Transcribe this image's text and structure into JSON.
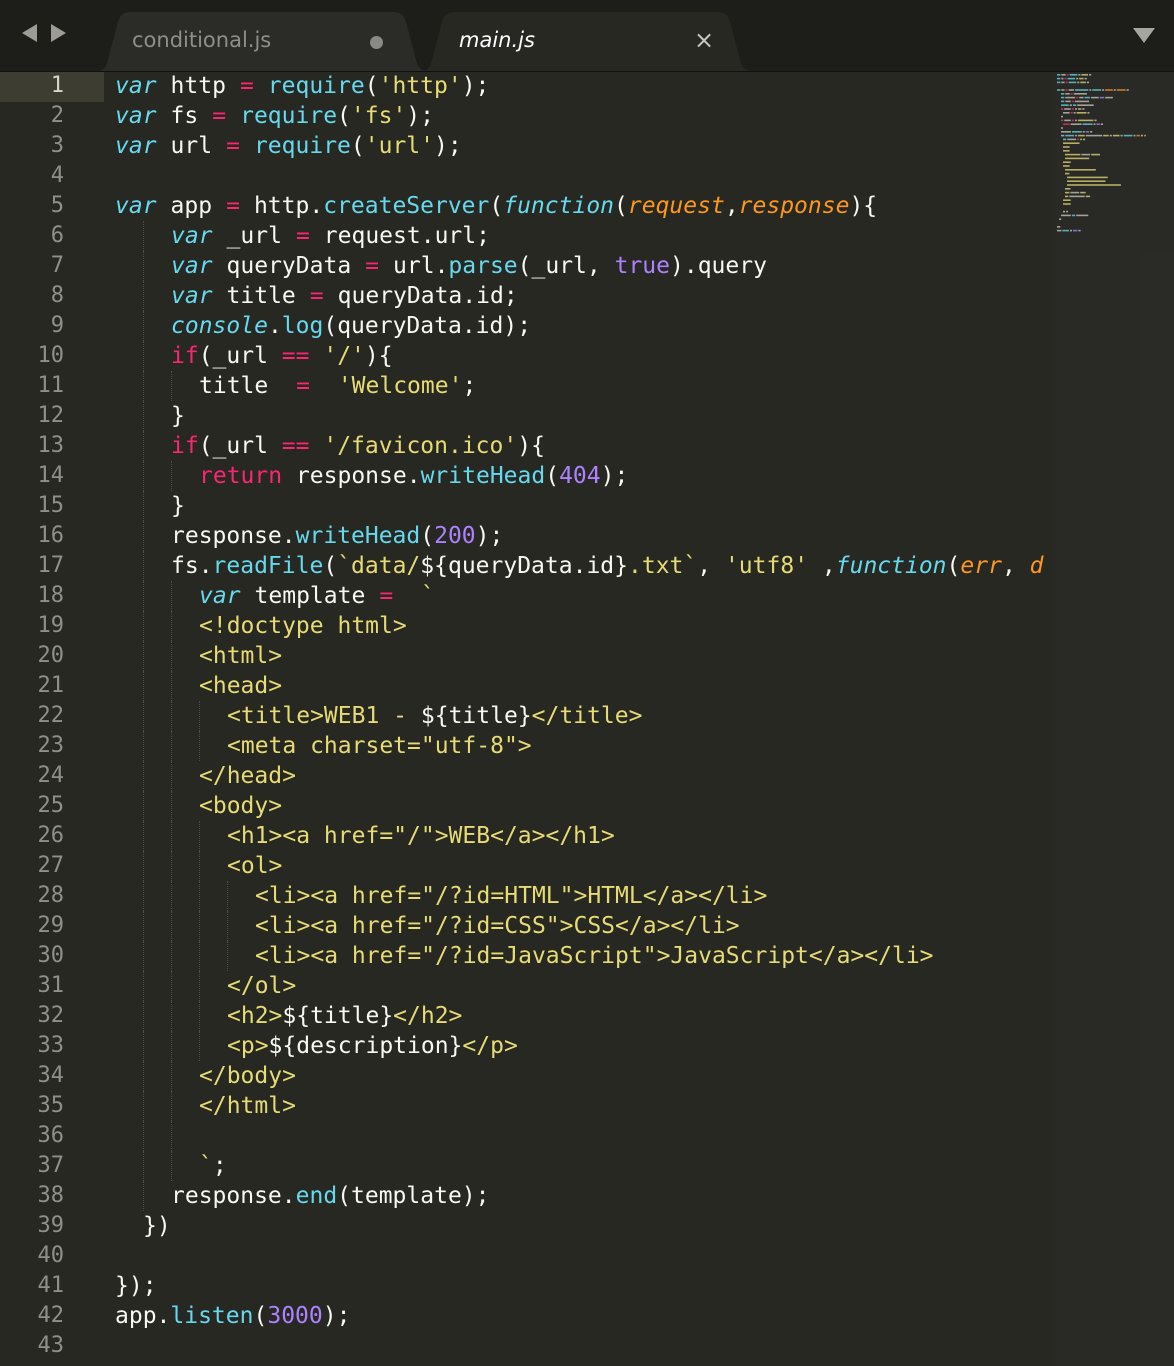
{
  "tabs": [
    {
      "label": "conditional.js",
      "active": false,
      "modified": true
    },
    {
      "label": "main.js",
      "active": true,
      "close_icon": "×"
    }
  ],
  "icons": {
    "back": "left-triangle-icon",
    "forward": "right-triangle-icon",
    "dropdown": "down-triangle-icon",
    "modified": "dot-icon",
    "close": "close-icon"
  },
  "colors": {
    "background": "#272822",
    "foreground": "#f8f8f2",
    "keyword": "#f92672",
    "storage": "#66d9ef",
    "string": "#e6db74",
    "number": "#ae81ff",
    "parameter": "#fd971f",
    "line_number": "#8f908a"
  },
  "editor": {
    "current_line": 1,
    "line_numbers": [
      "1",
      "2",
      "3",
      "4",
      "5",
      "6",
      "7",
      "8",
      "9",
      "10",
      "11",
      "12",
      "13",
      "14",
      "15",
      "16",
      "17",
      "18",
      "19",
      "20",
      "21",
      "22",
      "23",
      "24",
      "25",
      "26",
      "27",
      "28",
      "29",
      "30",
      "31",
      "32",
      "33",
      "34",
      "35",
      "36",
      "37",
      "38",
      "39",
      "40",
      "41",
      "42",
      "43"
    ],
    "lines": [
      [
        [
          "k",
          "var"
        ],
        [
          "",
          "http"
        ],
        [
          "op",
          "="
        ],
        [
          "fn",
          "require"
        ],
        [
          "",
          "("
        ],
        [
          "s",
          "'http'"
        ],
        [
          "",
          ");"
        ]
      ],
      [
        [
          "k",
          "var"
        ],
        [
          "",
          "fs"
        ],
        [
          "op",
          "="
        ],
        [
          "fn",
          "require"
        ],
        [
          "",
          "("
        ],
        [
          "s",
          "'fs'"
        ],
        [
          "",
          ");"
        ]
      ],
      [
        [
          "k",
          "var"
        ],
        [
          "",
          "url"
        ],
        [
          "op",
          "="
        ],
        [
          "fn",
          "require"
        ],
        [
          "",
          "("
        ],
        [
          "s",
          "'url'"
        ],
        [
          "",
          ");"
        ]
      ],
      [],
      [
        [
          "k",
          "var"
        ],
        [
          "",
          "app"
        ],
        [
          "op",
          "="
        ],
        [
          "",
          "http."
        ],
        [
          "fn",
          "createServer"
        ],
        [
          "",
          "("
        ],
        [
          "k",
          "function"
        ],
        [
          "",
          "("
        ],
        [
          "pa",
          "request"
        ],
        [
          "",
          ","
        ],
        [
          "pa",
          "response"
        ],
        [
          "",
          "){"
        ]
      ],
      [
        [
          "k",
          "var"
        ],
        [
          "",
          "_url"
        ],
        [
          "op",
          "="
        ],
        [
          "",
          "request.url;"
        ]
      ],
      [
        [
          "k",
          "var"
        ],
        [
          "",
          "queryData"
        ],
        [
          "op",
          "="
        ],
        [
          "",
          "url."
        ],
        [
          "fn",
          "parse"
        ],
        [
          "",
          "(_url, "
        ],
        [
          "num",
          "true"
        ],
        [
          "",
          ").query"
        ]
      ],
      [
        [
          "k",
          "var"
        ],
        [
          "",
          "title"
        ],
        [
          "op",
          "="
        ],
        [
          "",
          "queryData.id;"
        ]
      ],
      [
        [
          "k",
          "console"
        ],
        [
          "",
          " ."
        ],
        [
          "fn",
          "log"
        ],
        [
          "",
          "(queryData.id);"
        ]
      ],
      [
        [
          "kw",
          "if"
        ],
        [
          "",
          "(_url "
        ],
        [
          "op",
          "=="
        ],
        [
          "",
          " "
        ],
        [
          "s",
          "'/'"
        ],
        [
          "",
          "){"
        ]
      ],
      [
        [
          "",
          "title "
        ],
        [
          "op",
          "="
        ],
        [
          "",
          " "
        ],
        [
          "s",
          "'Welcome'"
        ],
        [
          "",
          ";"
        ]
      ],
      [
        [
          "",
          "}"
        ]
      ],
      [
        [
          "kw",
          "if"
        ],
        [
          "",
          "(_url "
        ],
        [
          "op",
          "=="
        ],
        [
          "",
          " "
        ],
        [
          "s",
          "'/favicon.ico'"
        ],
        [
          "",
          "){"
        ]
      ],
      [
        [
          "kw",
          "return"
        ],
        [
          "",
          " response."
        ],
        [
          "fn",
          "writeHead"
        ],
        [
          "",
          "("
        ],
        [
          "num",
          "404"
        ],
        [
          "",
          ");"
        ]
      ],
      [
        [
          "",
          "}"
        ]
      ],
      [
        [
          "",
          "response."
        ],
        [
          "fn",
          "writeHead"
        ],
        [
          "",
          "("
        ],
        [
          "num",
          "200"
        ],
        [
          "",
          ");"
        ]
      ],
      [
        [
          "",
          "fs."
        ],
        [
          "fn",
          "readFile"
        ],
        [
          "",
          "("
        ],
        [
          "s",
          "`data/"
        ],
        [
          "",
          "${queryData.id}"
        ],
        [
          "s",
          ".txt`"
        ],
        [
          "",
          ", "
        ],
        [
          "s",
          "'utf8'"
        ],
        [
          "",
          " ,"
        ],
        [
          "k",
          "function"
        ],
        [
          "",
          "("
        ],
        [
          "pa",
          "err"
        ],
        [
          "",
          ", "
        ],
        [
          "pa",
          "d"
        ]
      ],
      [
        [
          "k",
          "var"
        ],
        [
          "",
          "template"
        ],
        [
          "op",
          "="
        ],
        [
          "",
          " "
        ],
        [
          "s",
          "`"
        ]
      ],
      [
        [
          "s",
          "<!doctype html>"
        ]
      ],
      [
        [
          "s",
          "<html>"
        ]
      ],
      [
        [
          "s",
          "<head>"
        ]
      ],
      [
        [
          "s",
          "<title>WEB1 - "
        ],
        [
          "",
          "${title}"
        ],
        [
          "s",
          "</title>"
        ]
      ],
      [
        [
          "s",
          "<meta charset=\"utf-8\">"
        ]
      ],
      [
        [
          "s",
          "</head>"
        ]
      ],
      [
        [
          "s",
          "<body>"
        ]
      ],
      [
        [
          "s",
          "<h1><a href=\"/\">WEB</a></h1>"
        ]
      ],
      [
        [
          "s",
          "<ol>"
        ]
      ],
      [
        [
          "s",
          "<li><a href=\"/?id=HTML\">HTML</a></li>"
        ]
      ],
      [
        [
          "s",
          "<li><a href=\"/?id=CSS\">CSS</a></li>"
        ]
      ],
      [
        [
          "s",
          "<li><a href=\"/?id=JavaScript\">JavaScript</a></li>"
        ]
      ],
      [
        [
          "s",
          "</ol>"
        ]
      ],
      [
        [
          "s",
          "<h2>"
        ],
        [
          "",
          "${title}"
        ],
        [
          "s",
          "</h2>"
        ]
      ],
      [
        [
          "s",
          "<p>"
        ],
        [
          "",
          "${description}"
        ],
        [
          "s",
          "</p>"
        ]
      ],
      [
        [
          "s",
          "</body>"
        ]
      ],
      [
        [
          "s",
          "</html>"
        ]
      ],
      [],
      [
        [
          "s",
          "`"
        ],
        [
          "",
          ";"
        ]
      ],
      [
        [
          "",
          "response."
        ],
        [
          "fn",
          "end"
        ],
        [
          "",
          "(template);"
        ]
      ],
      [
        [
          "",
          "})"
        ]
      ],
      [],
      [
        [
          "",
          "});"
        ]
      ],
      [
        [
          "",
          "app."
        ],
        [
          "fn",
          "listen"
        ],
        [
          "",
          "("
        ],
        [
          "num",
          "3000"
        ],
        [
          "",
          ");"
        ]
      ],
      []
    ]
  }
}
